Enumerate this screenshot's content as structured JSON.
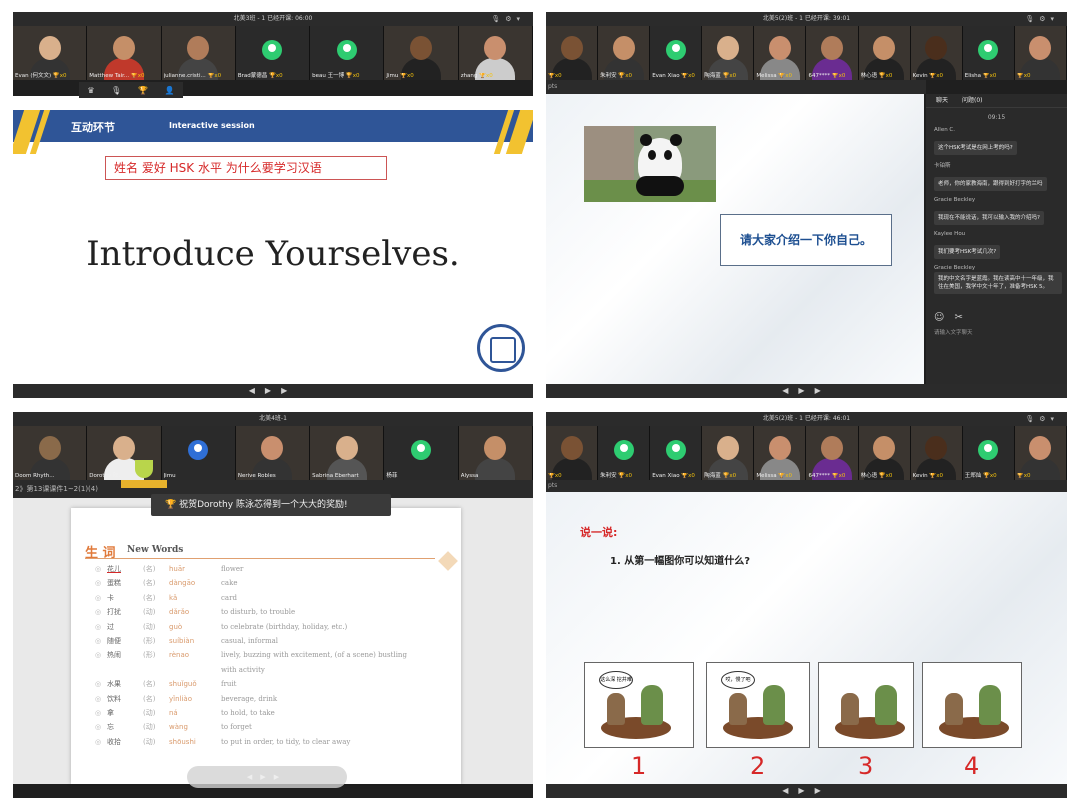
{
  "panel1": {
    "title": "北美3班 - 1   已经开课: 06:00",
    "participants": [
      {
        "name": "Evan (何文文)",
        "kind": "video",
        "skin": "#d9b08c",
        "shirt": "#333"
      },
      {
        "name": "Matthew Tair...",
        "kind": "video",
        "skin": "#c58f68",
        "shirt": "#c0392b"
      },
      {
        "name": "julianne.cristi...",
        "kind": "video",
        "skin": "#b07c5a",
        "shirt": "#444"
      },
      {
        "name": "Brad蒙德昌",
        "kind": "avatar"
      },
      {
        "name": "beau 王一博",
        "kind": "avatar"
      },
      {
        "name": "Jimu",
        "kind": "video",
        "skin": "#7a5234",
        "shirt": "#222"
      },
      {
        "name": "zhang",
        "kind": "video",
        "skin": "#c98f6e",
        "shirt": "#ccc"
      }
    ],
    "trophy_count": "x0",
    "banner_title": "互动环节",
    "banner_subtitle": "Interactive session",
    "prompt": "姓名  爱好   HSK 水平  为什么要学习汉语",
    "big_title": "Introduce Yourselves."
  },
  "panel2": {
    "title": "北美5(2)班 - 1   已经开课: 39:01",
    "participants": [
      {
        "name": "",
        "kind": "video",
        "skin": "#7a5234",
        "shirt": "#222"
      },
      {
        "name": "朱利安",
        "kind": "video",
        "skin": "#c58f68",
        "shirt": "#333"
      },
      {
        "name": "Evan Xiao",
        "kind": "avatar"
      },
      {
        "name": "陶海蓝",
        "kind": "video",
        "skin": "#d9b08c",
        "shirt": "#444"
      },
      {
        "name": "Melissa",
        "kind": "video",
        "skin": "#c98f6e",
        "shirt": "#888"
      },
      {
        "name": "647****",
        "kind": "video",
        "skin": "#b07c5a",
        "shirt": "#6a2c91"
      },
      {
        "name": "林心语",
        "kind": "video",
        "skin": "#c58f68",
        "shirt": "#222"
      },
      {
        "name": "Kevin",
        "kind": "video",
        "skin": "#4a2e1c",
        "shirt": "#222"
      },
      {
        "name": "Elisha",
        "kind": "avatar"
      },
      {
        "name": "",
        "kind": "video",
        "skin": "#c98f6e",
        "shirt": "#333"
      }
    ],
    "trophy_count": "x0",
    "subbar_text": "pts",
    "intro_text": "请大家介绍一下你自己。",
    "chat": {
      "tab_chat": "聊天",
      "tab_qa": "问题(0)",
      "time": "09:15",
      "messages": [
        {
          "name": "Allen C.",
          "text": "这个HSK考试是在网上考的吗?"
        },
        {
          "name": "卡铂斯",
          "text": "老师，你的家教海南，跟得到好打字的兰吗"
        },
        {
          "name": "Gracie Beckley",
          "text": "我现在不能说话，我可以输入我的介绍吗?"
        },
        {
          "name": "Kaylee Hou",
          "text": "我们要考HSK考试几次?"
        },
        {
          "name": "Gracie Beckley",
          "text": "我的中文名字是蓝霞。我在读高中十一年级，我住在美国，我学中文十年了，准备考HSK 5。"
        }
      ],
      "input_placeholder": "请输入文字聊天"
    }
  },
  "panel3": {
    "title": "北美4班-1",
    "participants": [
      {
        "name": "Doom Rhyth...",
        "kind": "video",
        "skin": "#8a6a4a",
        "shirt": "#333"
      },
      {
        "name": "Dorothy 陈...",
        "kind": "video",
        "skin": "#d9b08c",
        "shirt": "#eee"
      },
      {
        "name": "Jimu",
        "kind": "avatar-blue"
      },
      {
        "name": "Nerive Robles",
        "kind": "video",
        "skin": "#c98f6e",
        "shirt": "#333"
      },
      {
        "name": "Sabrina Eberhart",
        "kind": "video",
        "skin": "#d9b08c",
        "shirt": "#555"
      },
      {
        "name": "杨菲",
        "kind": "avatar"
      },
      {
        "name": "Alyssa",
        "kind": "video",
        "skin": "#c58f68",
        "shirt": "#444"
      }
    ],
    "lesson_label": "2》第13课课件1~2(1)(4)",
    "award_text": "祝贺Dorothy 陈泳芯得到一个大大的奖励!",
    "words_heading_cn": "生 词",
    "words_heading_en": "New Words",
    "words": [
      {
        "cn": "花儿",
        "pos": "(名)",
        "py": "huār",
        "en": "flower"
      },
      {
        "cn": "蛋糕",
        "pos": "(名)",
        "py": "dàngāo",
        "en": "cake"
      },
      {
        "cn": "卡",
        "pos": "(名)",
        "py": "kǎ",
        "en": "card"
      },
      {
        "cn": "打扰",
        "pos": "(动)",
        "py": "dǎrǎo",
        "en": "to disturb, to trouble"
      },
      {
        "cn": "过",
        "pos": "(动)",
        "py": "guò",
        "en": "to celebrate (birthday, holiday, etc.)"
      },
      {
        "cn": "随便",
        "pos": "(形)",
        "py": "suíbiàn",
        "en": "casual, informal"
      },
      {
        "cn": "热闹",
        "pos": "(形)",
        "py": "rènao",
        "en": "lively, buzzing with excitement, (of a scene) bustling"
      },
      {
        "cn": "",
        "pos": "",
        "py": "",
        "en": "with activity"
      },
      {
        "cn": "水果",
        "pos": "(名)",
        "py": "shuǐguǒ",
        "en": "fruit"
      },
      {
        "cn": "饮料",
        "pos": "(名)",
        "py": "yǐnliào",
        "en": "beverage, drink"
      },
      {
        "cn": "拿",
        "pos": "(动)",
        "py": "ná",
        "en": "to hold, to take"
      },
      {
        "cn": "忘",
        "pos": "(动)",
        "py": "wàng",
        "en": "to forget"
      },
      {
        "cn": "收拾",
        "pos": "(动)",
        "py": "shōushi",
        "en": "to put in order, to tidy, to clear away"
      }
    ]
  },
  "panel4": {
    "title": "北美5(2)班 - 1   已经开课: 46:01",
    "participants": [
      {
        "name": "",
        "kind": "video",
        "skin": "#7a5234",
        "shirt": "#222"
      },
      {
        "name": "朱利安",
        "kind": "avatar"
      },
      {
        "name": "Evan Xiao",
        "kind": "avatar"
      },
      {
        "name": "陶海蓝",
        "kind": "video",
        "skin": "#d9b08c",
        "shirt": "#444"
      },
      {
        "name": "Melissa",
        "kind": "video",
        "skin": "#c98f6e",
        "shirt": "#888"
      },
      {
        "name": "647****",
        "kind": "video",
        "skin": "#b07c5a",
        "shirt": "#6a2c91"
      },
      {
        "name": "林心语",
        "kind": "video",
        "skin": "#c58f68",
        "shirt": "#222"
      },
      {
        "name": "Kevin",
        "kind": "video",
        "skin": "#4a2e1c",
        "shirt": "#222"
      },
      {
        "name": "王郑灿",
        "kind": "avatar"
      },
      {
        "name": "",
        "kind": "video",
        "skin": "#c98f6e",
        "shirt": "#333"
      }
    ],
    "trophy_count": "x0",
    "subbar_text": "pts",
    "label": "说一说:",
    "question": "1. 从第一幅图你可以知道什么?",
    "comics": [
      {
        "number": "1",
        "bubble": "这么深 挖井难"
      },
      {
        "number": "2",
        "bubble": "哎，慢了吧"
      },
      {
        "number": "3",
        "bubble": ""
      },
      {
        "number": "4",
        "bubble": ""
      }
    ]
  }
}
